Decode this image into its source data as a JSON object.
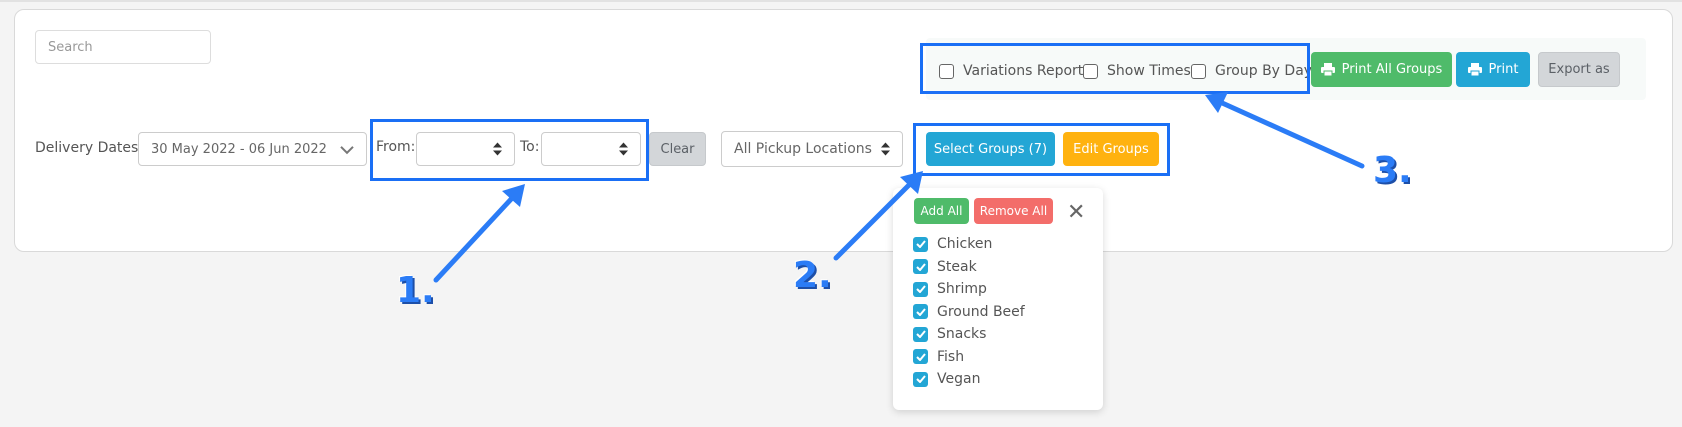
{
  "search": {
    "placeholder": "Search"
  },
  "options": {
    "variations_report": "Variations Report",
    "show_times": "Show Times",
    "group_by_day": "Group By Day"
  },
  "actions": {
    "print_all_groups": "Print All Groups",
    "print": "Print",
    "export": "Export as"
  },
  "filters": {
    "delivery_dates_label": "Delivery Dates:",
    "delivery_dates_value": "30 May 2022 - 06 Jun 2022",
    "from_label": "From:",
    "to_label": "To:",
    "clear": "Clear",
    "pickup_locations": "All Pickup Locations",
    "select_groups": "Select Groups (7)",
    "edit_groups": "Edit Groups"
  },
  "groups_dropdown": {
    "add_all": "Add All",
    "remove_all": "Remove All",
    "close": "✕",
    "items": [
      {
        "label": "Chicken",
        "checked": true
      },
      {
        "label": "Steak",
        "checked": true
      },
      {
        "label": "Shrimp",
        "checked": true
      },
      {
        "label": "Ground Beef",
        "checked": true
      },
      {
        "label": "Snacks",
        "checked": true
      },
      {
        "label": "Fish",
        "checked": true
      },
      {
        "label": "Vegan",
        "checked": true
      }
    ]
  },
  "annotations": {
    "one": "1.",
    "two": "2.",
    "three": "3."
  },
  "colors": {
    "green": "#4fbb6a",
    "blue": "#23a6d5",
    "orange": "#ffb20f",
    "red": "#f36d6a",
    "highlight": "#1a6ff5"
  }
}
